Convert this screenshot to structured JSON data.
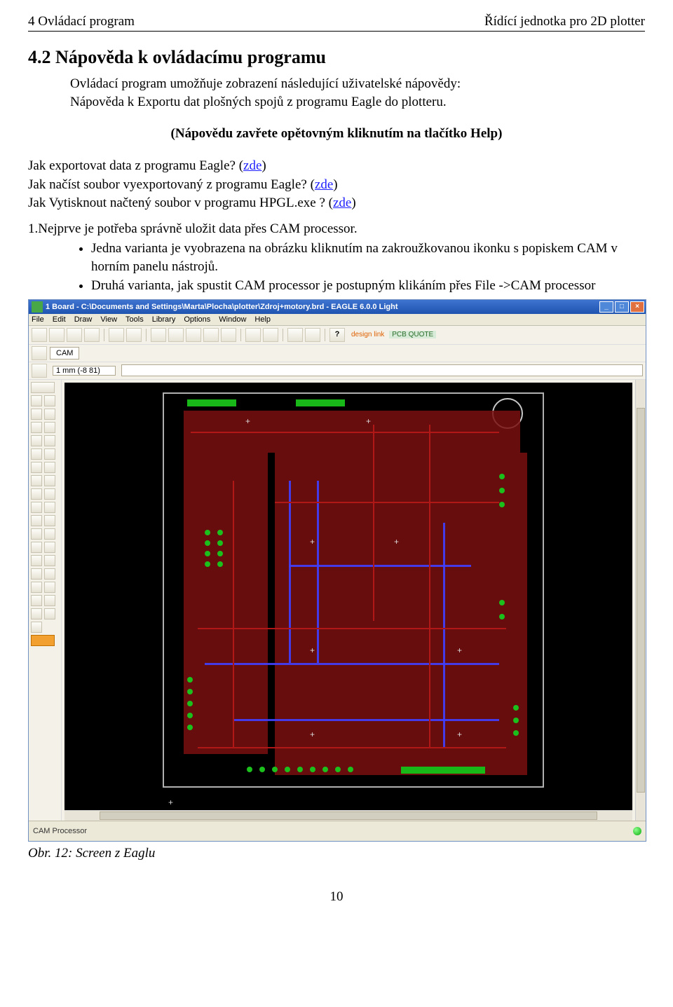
{
  "header": {
    "left": "4 Ovládací program",
    "right": "Řídící jednotka pro 2D plotter"
  },
  "sectionTitle": "4.2 Nápověda k ovládacímu programu",
  "intro": {
    "line1": "Ovládací program umožňuje zobrazení následující uživatelské nápovědy:",
    "line2": "Nápověda k Exportu dat plošných spojů z programu Eagle do plotteru."
  },
  "centeredNote": "(Nápovědu zavřete opětovným kliknutím na tlačítko Help)",
  "q": {
    "q1a": "Jak exportovat data z programu  Eagle? (",
    "q1link": "zde",
    "q1b": ")",
    "q2a": "Jak načíst soubor vyexportovaný z programu Eagle? (",
    "q2link": "zde",
    "q2b": ")",
    "q3a": "Jak Vytisknout načtený soubor v programu HPGL.exe ? (",
    "q3link": "zde",
    "q3b": ")"
  },
  "step1": "1.Nejprve je potřeba správně uložit data přes CAM processor.",
  "bullets": {
    "b1": "Jedna varianta je vyobrazena na obrázku kliknutím na zakroužkovanou ikonku s popiskem CAM v horním panelu nástrojů.",
    "b2": "Druhá varianta, jak spustit CAM processor je postupným klikáním přes File ->CAM processor"
  },
  "eagle": {
    "title": "1 Board - C:\\Documents and Settings\\Marta\\Plocha\\plotter\\Zdroj+motory.brd - EAGLE 6.0.0 Light",
    "menu": [
      "File",
      "Edit",
      "Draw",
      "View",
      "Tools",
      "Library",
      "Options",
      "Window",
      "Help"
    ],
    "designLink": "design link",
    "pcbQuote": "PCB QUOTE",
    "camLabel": "CAM",
    "mmLabel": "1 mm (-8 81)",
    "status": "CAM Processor"
  },
  "caption": "Obr. 12: Screen z Eaglu",
  "pageNumber": "10"
}
